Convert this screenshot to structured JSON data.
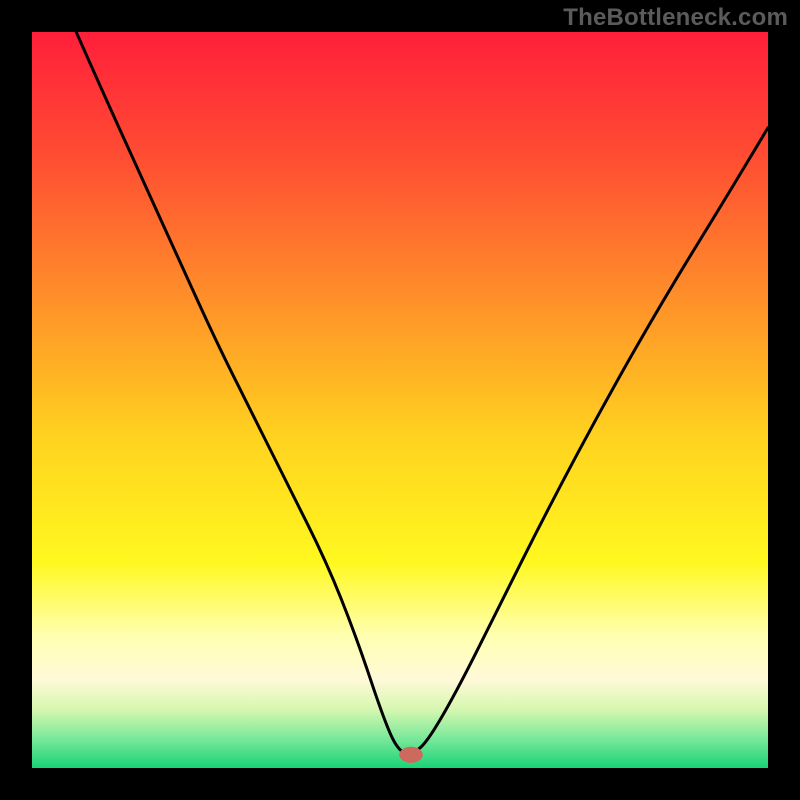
{
  "watermark": "TheBottleneck.com",
  "chart_data": {
    "type": "line",
    "title": "",
    "xlabel": "",
    "ylabel": "",
    "xlim": [
      0,
      1
    ],
    "ylim": [
      0,
      1
    ],
    "gradient_stops": [
      {
        "offset": 0.0,
        "color": "#ff1f3a"
      },
      {
        "offset": 0.16,
        "color": "#ff4a33"
      },
      {
        "offset": 0.35,
        "color": "#ff8b2a"
      },
      {
        "offset": 0.55,
        "color": "#ffd21f"
      },
      {
        "offset": 0.72,
        "color": "#fff81f"
      },
      {
        "offset": 0.82,
        "color": "#ffffb0"
      },
      {
        "offset": 0.88,
        "color": "#fff9d8"
      },
      {
        "offset": 0.92,
        "color": "#d6f7b0"
      },
      {
        "offset": 0.96,
        "color": "#7ae89a"
      },
      {
        "offset": 1.0,
        "color": "#18d477"
      }
    ],
    "curve": {
      "x": [
        0.06,
        0.1,
        0.15,
        0.2,
        0.25,
        0.3,
        0.35,
        0.4,
        0.44,
        0.48,
        0.5,
        0.52,
        0.54,
        0.58,
        0.63,
        0.7,
        0.78,
        0.86,
        0.94,
        1.0
      ],
      "y": [
        1.0,
        0.91,
        0.8,
        0.69,
        0.58,
        0.48,
        0.38,
        0.28,
        0.18,
        0.06,
        0.02,
        0.02,
        0.04,
        0.11,
        0.21,
        0.35,
        0.5,
        0.64,
        0.77,
        0.87
      ]
    },
    "marker": {
      "x": 0.515,
      "y": 0.018,
      "rx": 0.016,
      "ry": 0.011,
      "fill": "#cc6a5d"
    }
  }
}
